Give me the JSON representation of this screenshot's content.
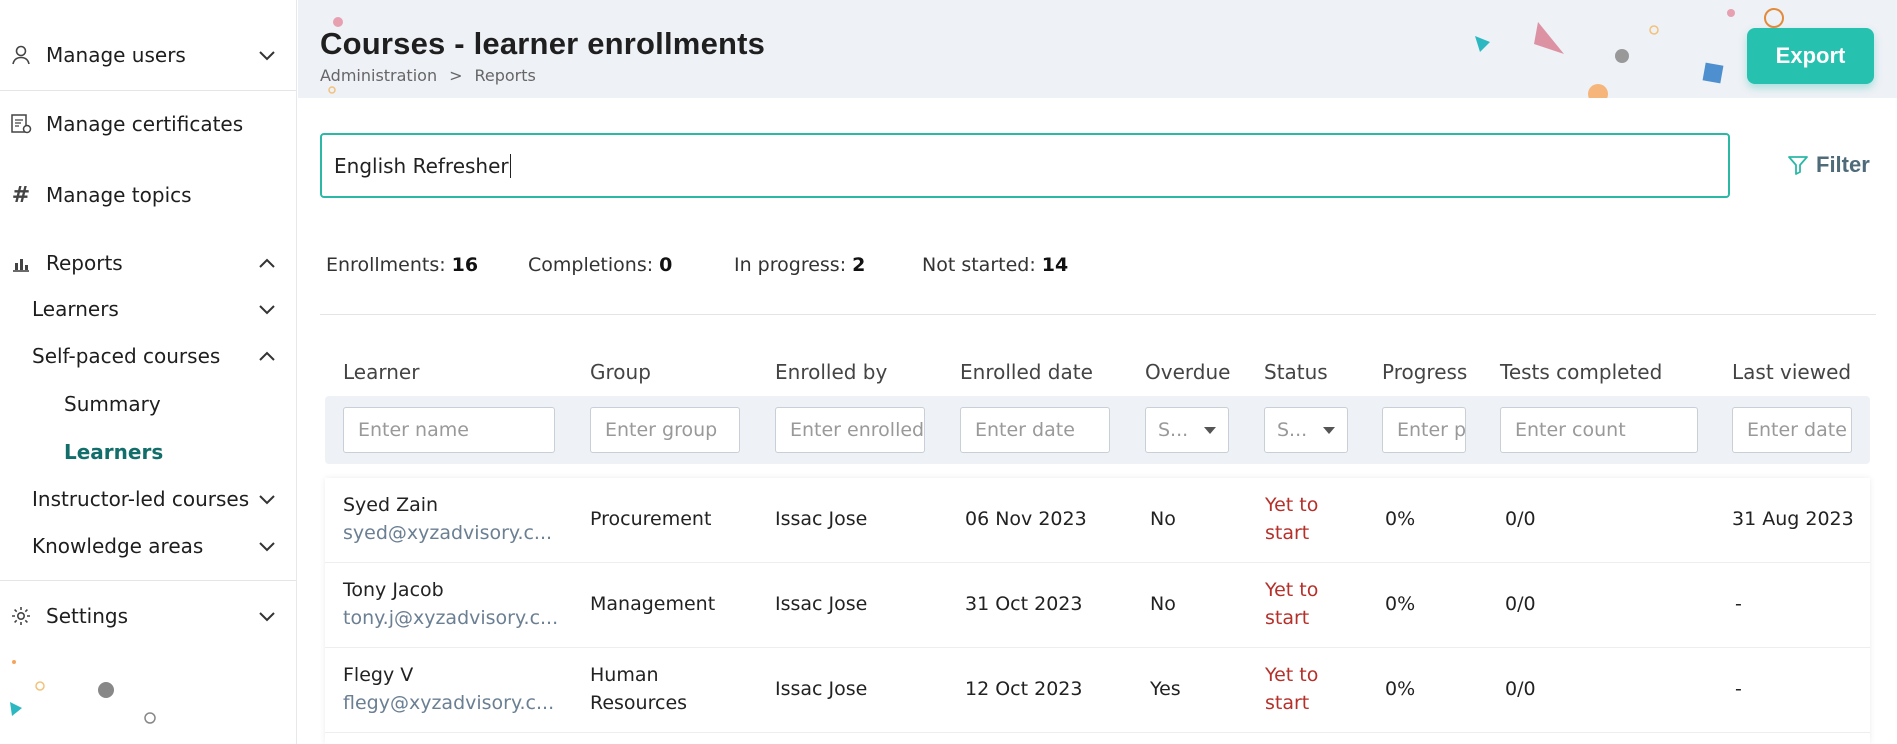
{
  "sidebar": {
    "manage_users": "Manage users",
    "manage_certificates": "Manage certificates",
    "manage_topics": "Manage topics",
    "reports": "Reports",
    "learners": "Learners",
    "self_paced_courses": "Self-paced courses",
    "summary": "Summary",
    "learners_active": "Learners",
    "instructor_led_courses": "Instructor-led courses",
    "knowledge_areas": "Knowledge areas",
    "settings": "Settings",
    "hash_glyph": "#"
  },
  "header": {
    "title": "Courses - learner enrollments",
    "breadcrumb": [
      "Administration",
      ">",
      "Reports"
    ],
    "export_label": "Export",
    "accent_color": "#27c1b0"
  },
  "search": {
    "value": "English Refresher"
  },
  "filter_label": "Filter",
  "stats": {
    "enrollments_label": "Enrollments:",
    "enrollments": "16",
    "completions_label": "Completions:",
    "completions": "0",
    "in_progress_label": "In progress:",
    "in_progress": "2",
    "not_started_label": "Not started:",
    "not_started": "14"
  },
  "table": {
    "columns": [
      "Learner",
      "Group",
      "Enrolled by",
      "Enrolled date",
      "Overdue",
      "Status",
      "Progress",
      "Tests completed",
      "Last viewed"
    ],
    "filters": {
      "learner": "Enter name",
      "group": "Enter group",
      "enrolled_by": "Enter enrolled by",
      "enrolled_date": "Enter date",
      "overdue": "S...",
      "status": "S...",
      "progress": "Enter progress",
      "tests": "Enter count",
      "last_viewed": "Enter date"
    },
    "rows": [
      {
        "name": "Syed Zain",
        "email": "syed@xyzadvisory.c...",
        "group": "Procurement",
        "enrolled_by": "Issac Jose",
        "date": "06 Nov 2023",
        "overdue": "No",
        "status_line1": "Yet to",
        "status_line2": "start",
        "progress": "0%",
        "tests": "0/0",
        "last_viewed": "31 Aug 2023"
      },
      {
        "name": "Tony Jacob",
        "email": "tony.j@xyzadvisory.c...",
        "group": "Management",
        "enrolled_by": "Issac Jose",
        "date": "31 Oct 2023",
        "overdue": "No",
        "status_line1": "Yet to",
        "status_line2": "start",
        "progress": "0%",
        "tests": "0/0",
        "last_viewed": "-"
      },
      {
        "name": "Flegy V",
        "email": "flegy@xyzadvisory.c...",
        "group_line1": "Human",
        "group_line2": "Resources",
        "enrolled_by": "Issac Jose",
        "date": "12 Oct 2023",
        "overdue": "Yes",
        "status_line1": "Yet to",
        "status_line2": "start",
        "progress": "0%",
        "tests": "0/0",
        "last_viewed": "-"
      }
    ]
  }
}
